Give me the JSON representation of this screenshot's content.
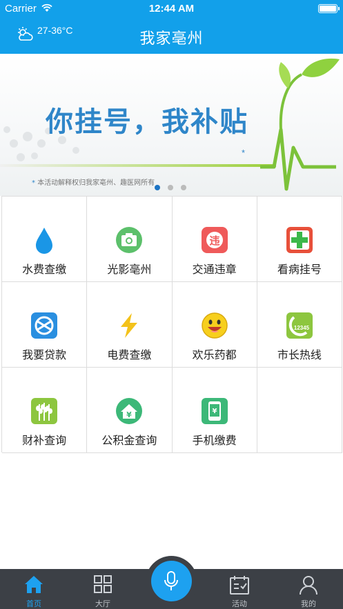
{
  "status_bar": {
    "carrier": "Carrier",
    "time": "12:44 AM"
  },
  "header": {
    "temperature": "27-36°C",
    "title": "我家亳州",
    "weather_icon": "partly-cloudy-icon"
  },
  "banner": {
    "headline": "你挂号，我补贴",
    "caption": "本活动解释权归我家亳州、趣医网所有",
    "page_count": 3,
    "active_page": 1
  },
  "services": [
    {
      "label": "水费查缴",
      "icon": "water-drop-icon",
      "color": "#1a96e6"
    },
    {
      "label": "光影亳州",
      "icon": "camera-icon",
      "color": "#5cc06b"
    },
    {
      "label": "交通违章",
      "icon": "traffic-violation-icon",
      "color": "#ef5a5a"
    },
    {
      "label": "看病挂号",
      "icon": "medical-cross-icon",
      "color": "#e8503a"
    },
    {
      "label": "我要贷款",
      "icon": "loan-icon",
      "color": "#2a8fe0"
    },
    {
      "label": "电费查缴",
      "icon": "lightning-icon",
      "color": "#f3c21b"
    },
    {
      "label": "欢乐药都",
      "icon": "smiley-icon",
      "color": "#f7cf1d"
    },
    {
      "label": "市长热线",
      "icon": "hotline-12345-icon",
      "color": "#8dc63f"
    },
    {
      "label": "财补查询",
      "icon": "wheat-icon",
      "color": "#8dc63f"
    },
    {
      "label": "公积金查询",
      "icon": "housing-fund-icon",
      "color": "#3cb878"
    },
    {
      "label": "手机缴费",
      "icon": "phone-payment-icon",
      "color": "#3cb878"
    }
  ],
  "tabbar": {
    "tabs": [
      {
        "label": "首页",
        "icon": "home-icon",
        "active": true
      },
      {
        "label": "大厅",
        "icon": "grid-icon",
        "active": false
      },
      {
        "label": "活动",
        "icon": "calendar-icon",
        "active": false
      },
      {
        "label": "我的",
        "icon": "user-icon",
        "active": false
      }
    ],
    "center_icon": "microphone-icon"
  },
  "colors": {
    "primary": "#12a0ea",
    "tabbar": "#3c4046",
    "tab_active": "#1da1f0"
  }
}
